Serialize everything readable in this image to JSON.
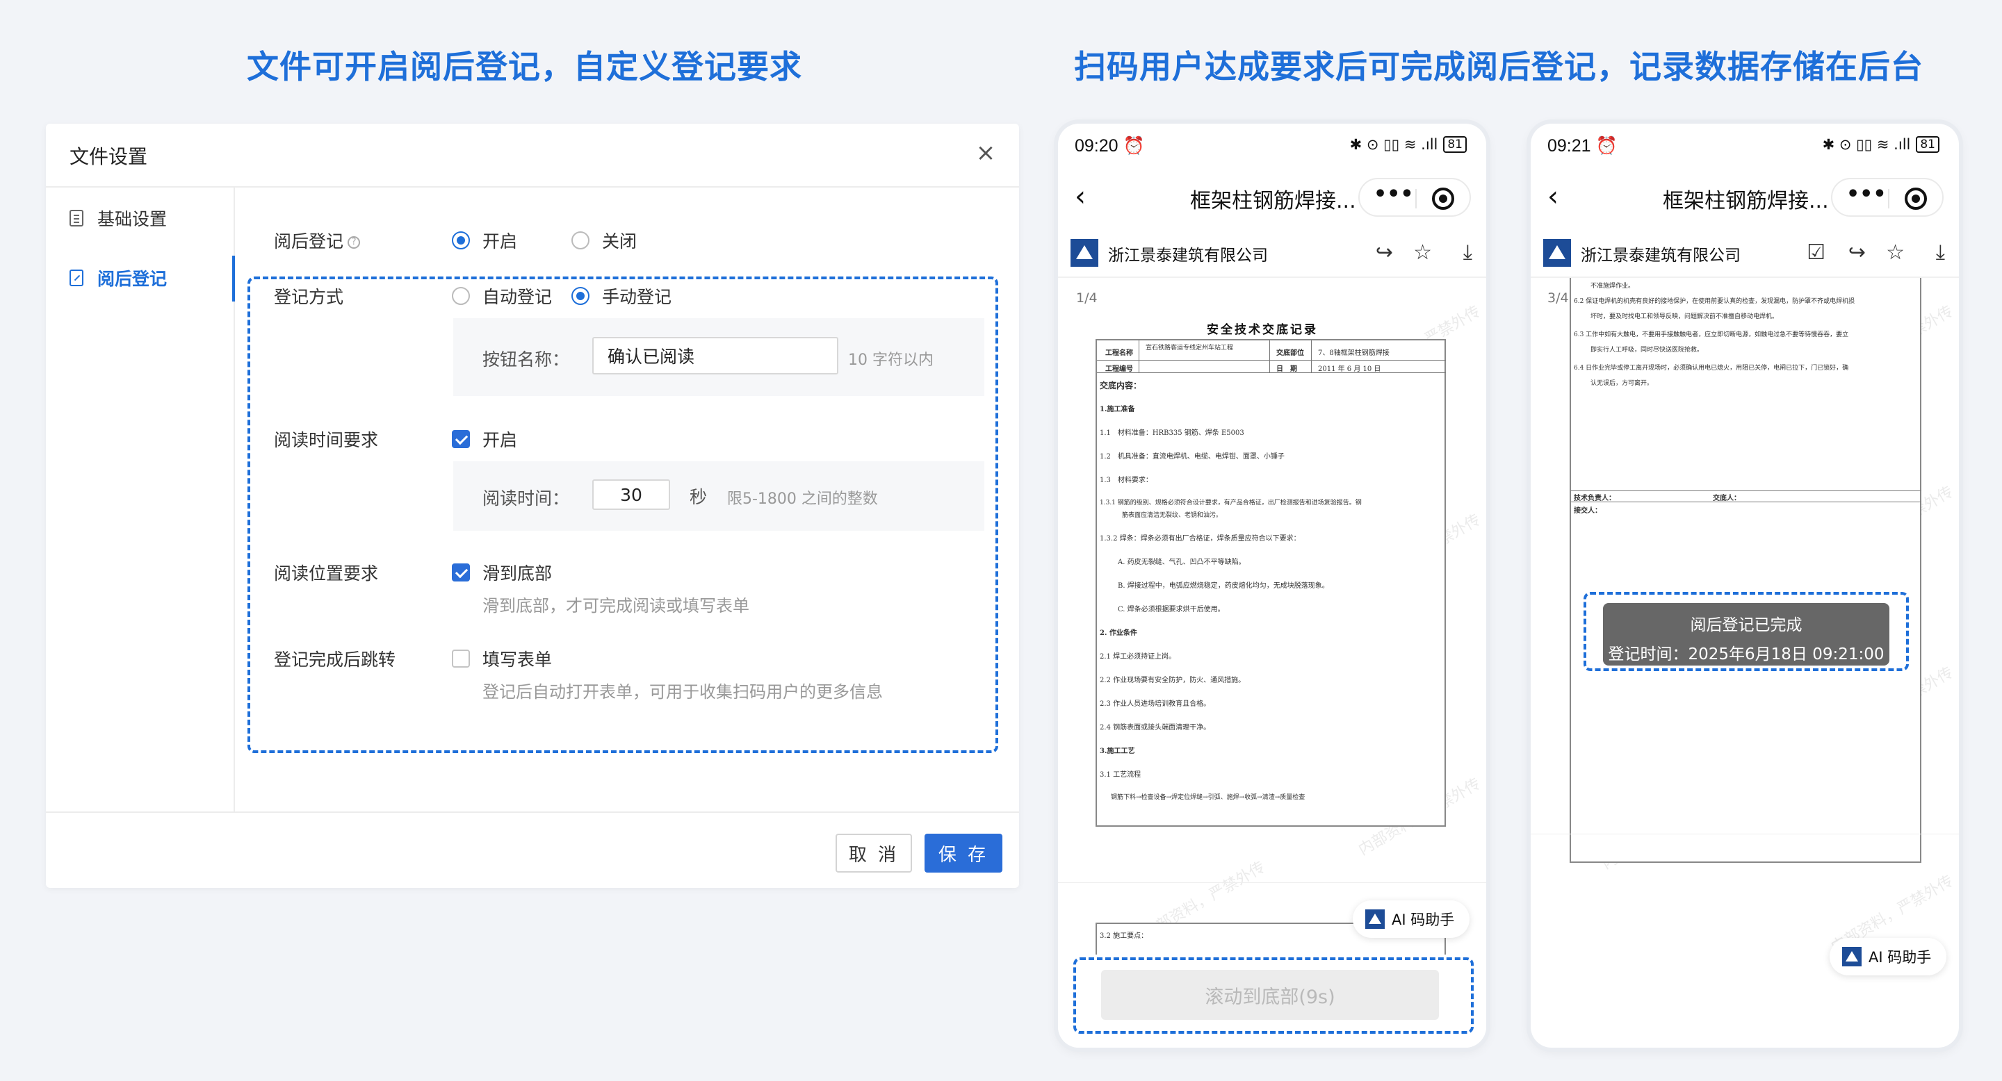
{
  "headlines": {
    "left": "文件可开启阅后登记，自定义登记要求",
    "right": "扫码用户达成要求后可完成阅后登记，记录数据存储在后台"
  },
  "dialog": {
    "title": "文件设置",
    "close": "×",
    "sidebar": [
      {
        "label": "基础设置"
      },
      {
        "label": "阅后登记"
      }
    ],
    "reg_label": "阅后登记",
    "reg_help": "?",
    "reg_on": "开启",
    "reg_off": "关闭",
    "method_label": "登记方式",
    "method_auto": "自动登记",
    "method_manual": "手动登记",
    "button_name_label": "按钮名称：",
    "button_name_value": "确认已阅读",
    "button_name_hint": "10 字符以内",
    "read_time_label": "阅读时间要求",
    "read_time_on": "开启",
    "read_time_field_label": "阅读时间：",
    "read_time_value": "30",
    "read_time_unit": "秒",
    "read_time_hint": "限5-1800 之间的整数",
    "position_label": "阅读位置要求",
    "position_option": "滑到底部",
    "position_desc": "滑到底部，才可完成阅读或填写表单",
    "redirect_label": "登记完成后跳转",
    "redirect_option": "填写表单",
    "redirect_desc": "登记后自动打开表单，可用于收集扫码用户的更多信息",
    "cancel": "取 消",
    "save": "保 存"
  },
  "phone1": {
    "time": "09:20",
    "alarm": "⏰",
    "status_icons": "✱ ⊙ ▯▯ ≋ .ıll",
    "battery": "81",
    "nav_title": "框架柱钢筋焊接...",
    "company": "浙江景泰建筑有限公司",
    "page_indicator": "1/4",
    "doc_title": "安全技术交底记录",
    "doc_header": {
      "project_name_label": "工程名称",
      "project_name_value": "宣石铁路客运专线定州车站工程",
      "topic_label": "交底部位",
      "topic_value": "7、8轴框架柱钢筋焊接",
      "number_label": "工程编号",
      "date_label": "日　期",
      "date_value": "2011 年 6 月 10 日"
    },
    "doc_lines": [
      "交底内容：",
      "1.施工准备",
      "1.1　材料准备：HRB335 钢筋、焊条 E5003",
      "1.2　机具准备：直流电焊机、电缆、电焊钳、面罩、小锤子",
      "1.3　材料要求：",
      "1.3.1 钢筋的级别、规格必须符合设计要求，有产品合格证，出厂检测报告和进场复验报告。钢",
      "筋表面应清洁无裂纹、老锈和油污。",
      "1.3.2 焊条：焊条必须有出厂合格证，焊条质量应符合以下要求：",
      "A. 药皮无裂缝、气孔、凹凸不平等缺陷。",
      "B. 焊接过程中，电弧应燃烧稳定，药皮熔化均匀，无成块脱落现象。",
      "C. 焊条必须根据要求烘干后使用。",
      "2. 作业条件",
      "2.1 焊工必须持证上岗。",
      "2.2 作业现场要有安全防护，防火、通风措施。",
      "2.3 作业人员进场培训教育且合格。",
      "2.4 钢筋表面或接头端面清理干净。",
      "3.施工工艺",
      "3.1 工艺流程",
      "钢筋下料→检查设备→焊定位焊缝→引弧、施焊→收弧→清渣→质量检查"
    ],
    "next_page_line": "3.2 施工要点：",
    "ai_helper": "AI 码助手",
    "scroll_button": "滚动到底部(9s)"
  },
  "phone2": {
    "time": "09:21",
    "alarm": "⏰",
    "status_icons": "✱ ⊙ ▯▯ ≋ .ıll",
    "battery": "81",
    "nav_title": "框架柱钢筋焊接...",
    "company": "浙江景泰建筑有限公司",
    "page_indicator": "3/4",
    "doc_lines": [
      "不准施焊作业。",
      "6.2 保证电焊机的机壳有良好的接地保护，在使用前要认真的检查，发现漏电，防护罩不齐或电焊机损",
      "坏时，要及时找电工和领导反映，问题解决前不准擅自移动电焊机。",
      "6.3 工作中如有大触电，不要用手接触触电者，应立即切断电源，如触电过急不要等待慢吞吞，要立",
      "即实行人工呼吸，同时尽快送医院抢救。",
      "6.4 日作业完毕或停工离开现场时，必须确认用电已熄火，用阻已关停，电闸已拉下，门已锁好，确",
      "认无误后，方可离开。"
    ],
    "sign_tech": "技术负责人：",
    "sign_discloser": "交底人：",
    "sign_receiver": "接交人：",
    "toast_title": "阅后登记已完成",
    "toast_time": "登记时间：2025年6月18日 09:21:00",
    "ai_helper": "AI 码助手"
  },
  "watermark": "内部资料，严禁外传",
  "colors": {
    "accent": "#1e6fd9",
    "save_button": "#2a6dd8",
    "logo": "#1d4c97",
    "background": "#f2f4f8"
  },
  "icons": {
    "close": "close-icon",
    "back": "chevron-left-icon",
    "more": "more-dots-icon",
    "target": "target-icon",
    "share": "share-icon",
    "star": "star-icon",
    "download": "download-icon",
    "register": "register-icon"
  }
}
